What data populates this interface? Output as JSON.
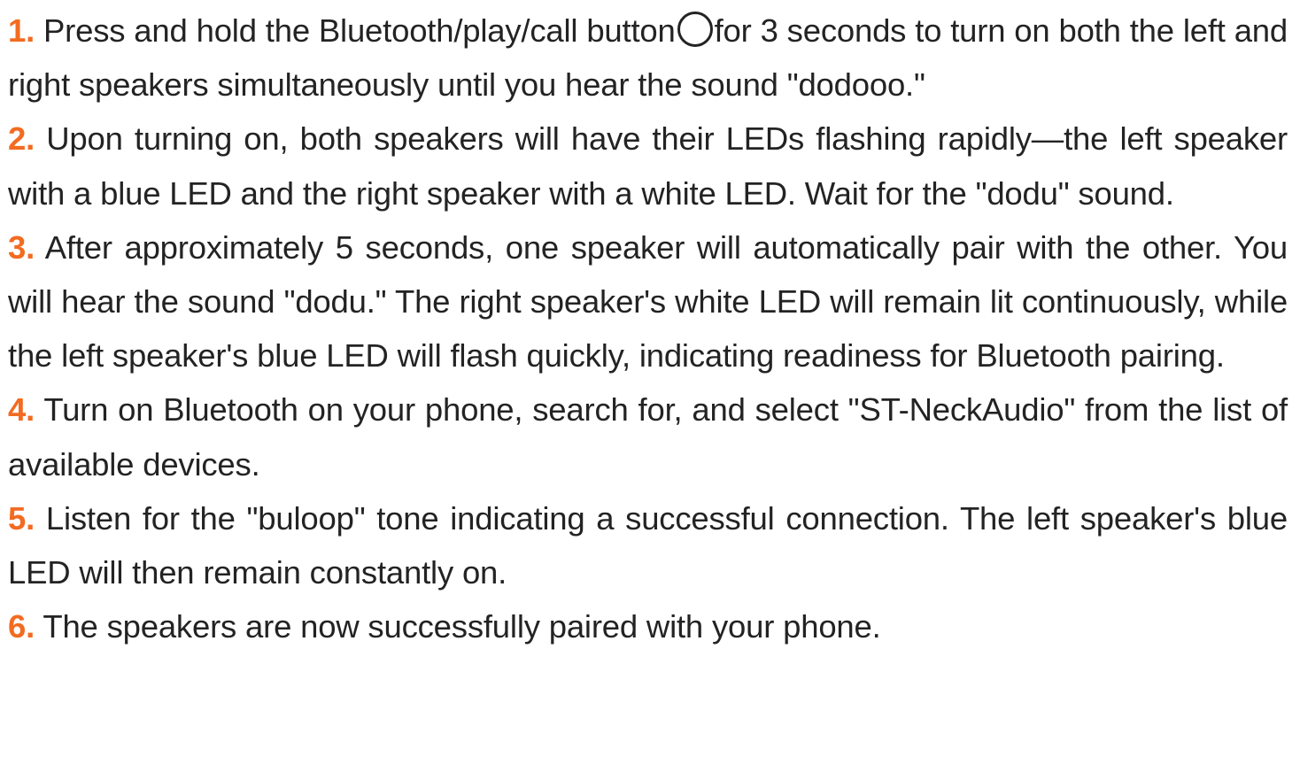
{
  "steps": [
    {
      "number": "1.",
      "text_before_icon": "Press and hold the Bluetooth/play/call button",
      "icon": "circle-button-icon",
      "text_after_icon": "for 3 seconds to turn on both the left and right speakers simultaneously until you hear the sound \"dodooo.\""
    },
    {
      "number": "2.",
      "text": "Upon turning on, both speakers will have their LEDs flashing rapidly—the left speaker with a blue LED and the right speaker with a white LED. Wait for the \"dodu\" sound."
    },
    {
      "number": "3.",
      "text": "After approximately 5 seconds, one speaker will automatically pair with the other. You will hear the sound \"dodu.\" The right speaker's white LED will remain lit continuously, while the left speaker's blue LED will flash quickly, indicating readiness for Bluetooth pairing."
    },
    {
      "number": "4.",
      "text": "Turn on Bluetooth on your phone, search for, and select \"ST-NeckAudio\" from the list of available devices."
    },
    {
      "number": "5.",
      "text": "Listen for the \"buloop\" tone indicating a successful connection. The left speaker's blue LED will then remain constantly on."
    },
    {
      "number": "6.",
      "text": "The speakers are now successfully paired with your phone."
    }
  ],
  "colors": {
    "step_number": "#f26b21",
    "body_text": "#232323",
    "background": "#ffffff"
  }
}
